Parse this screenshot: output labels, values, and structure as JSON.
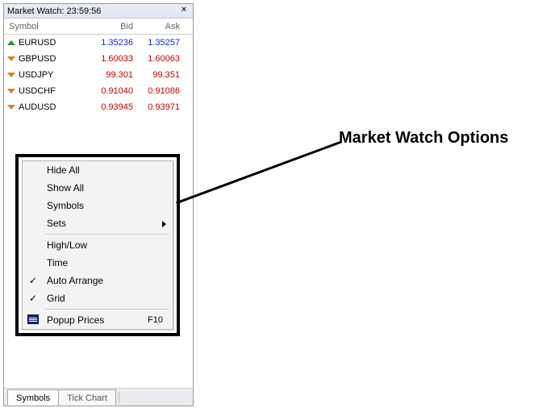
{
  "title": "Market Watch: 23:59:56",
  "columns": {
    "symbol": "Symbol",
    "bid": "Bid",
    "ask": "Ask"
  },
  "rows": [
    {
      "dir": "up",
      "symbol": "EURUSD",
      "bid": "1.35236",
      "ask": "1.35257",
      "color": "blue"
    },
    {
      "dir": "down",
      "symbol": "GBPUSD",
      "bid": "1.60033",
      "ask": "1.60063",
      "color": "red"
    },
    {
      "dir": "down",
      "symbol": "USDJPY",
      "bid": "99.301",
      "ask": "99.351",
      "color": "red"
    },
    {
      "dir": "down",
      "symbol": "USDCHF",
      "bid": "0.91040",
      "ask": "0.91086",
      "color": "red"
    },
    {
      "dir": "down",
      "symbol": "AUDUSD",
      "bid": "0.93945",
      "ask": "0.93971",
      "color": "red"
    }
  ],
  "menu": {
    "hide_all": "Hide All",
    "show_all": "Show All",
    "symbols": "Symbols",
    "sets": "Sets",
    "high_low": "High/Low",
    "time": "Time",
    "auto_arrange": "Auto Arrange",
    "grid": "Grid",
    "popup_prices": "Popup Prices",
    "popup_shortcut": "F10"
  },
  "tabs": {
    "symbols": "Symbols",
    "tick_chart": "Tick Chart"
  },
  "annotation": "Market Watch Options"
}
